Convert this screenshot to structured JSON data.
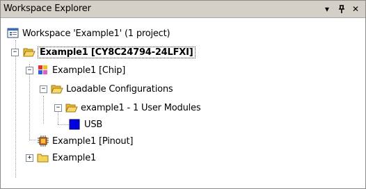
{
  "panel": {
    "title": "Workspace Explorer",
    "dropdown_glyph": "▾",
    "pin_glyph": "ᚩ",
    "close_glyph": "✕"
  },
  "tree": {
    "workspace": "Workspace 'Example1' (1 project)",
    "project": "Example1 [CY8C24794-24LFXI]",
    "chip": "Example1 [Chip]",
    "loadable": "Loadable Configurations",
    "config": "example1 - 1 User Modules",
    "usb": "USB",
    "pinout": "Example1 [Pinout]",
    "folder": "Example1"
  },
  "colors": {
    "titlebar": "#d4d0c8",
    "folder": "#f4d35a",
    "usb_module": "#0000e0"
  },
  "icons": {
    "workspace": "workspace-icon",
    "project": "open-folder-icon",
    "chip": "chip-icon",
    "loadable": "open-folder-icon",
    "config": "open-folder-icon",
    "usb": "user-module-icon",
    "pinout": "pinout-icon",
    "folder": "folder-icon"
  }
}
